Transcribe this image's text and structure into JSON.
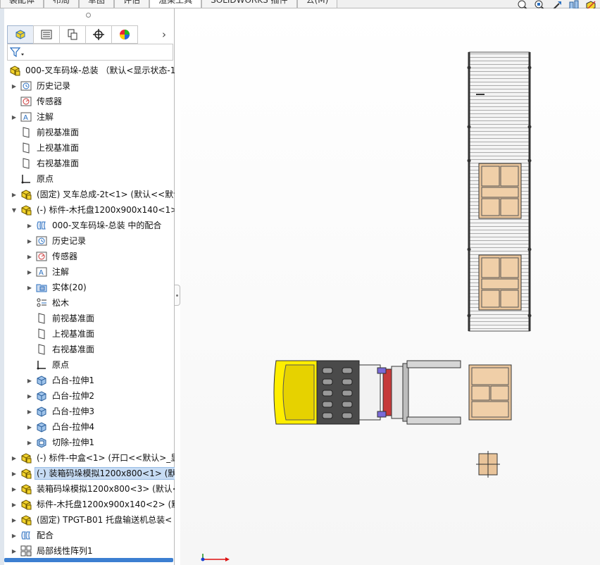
{
  "ribbon_tabs": [
    "装配体",
    "布局",
    "草图",
    "评估",
    "渲染工具",
    "SOLIDWORKS 插件",
    "公(M)"
  ],
  "active_ribbon_tab": 4,
  "view_tools": [
    "zoom-to-fit-icon",
    "zoom-to-area-icon",
    "previous-view-icon",
    "section-view-icon",
    "view-orientation-icon"
  ],
  "panel_tabs": [
    "feature-manager-icon",
    "property-manager-icon",
    "configuration-manager-icon",
    "dimxpert-icon",
    "display-manager-icon"
  ],
  "colors": {
    "selection": "#c7dcf4",
    "part_yellow": "#f2d22b",
    "pallet_wood": "#e9c49a",
    "forklift_yellow": "#ffee00",
    "scrollbar": "#3c7fd1"
  },
  "tree": [
    {
      "depth": 0,
      "expander": "none",
      "icon": "assembly-icon",
      "label": "000-叉车码垛-总装 （默认<显示状态-1>"
    },
    {
      "depth": 1,
      "expander": "closed",
      "icon": "history-icon",
      "label": "历史记录"
    },
    {
      "depth": 1,
      "expander": "none",
      "icon": "sensor-icon",
      "label": "传感器"
    },
    {
      "depth": 1,
      "expander": "closed",
      "icon": "annotation-icon",
      "label": "注解"
    },
    {
      "depth": 1,
      "expander": "none",
      "icon": "plane-icon",
      "label": "前视基准面"
    },
    {
      "depth": 1,
      "expander": "none",
      "icon": "plane-icon",
      "label": "上视基准面"
    },
    {
      "depth": 1,
      "expander": "none",
      "icon": "plane-icon",
      "label": "右视基准面"
    },
    {
      "depth": 1,
      "expander": "none",
      "icon": "origin-icon",
      "label": "原点"
    },
    {
      "depth": 1,
      "expander": "closed",
      "icon": "subassembly-icon",
      "label": "(固定) 叉车总成-2t<1> (默认<<默认"
    },
    {
      "depth": 1,
      "expander": "open",
      "icon": "subassembly-icon",
      "label": "(-) 标件-木托盘1200x900x140<1>"
    },
    {
      "depth": 2,
      "expander": "closed",
      "icon": "mates-folder-icon",
      "label": "000-叉车码垛-总装 中的配合"
    },
    {
      "depth": 2,
      "expander": "closed",
      "icon": "history-icon",
      "label": "历史记录"
    },
    {
      "depth": 2,
      "expander": "closed",
      "icon": "sensor-icon",
      "label": "传感器"
    },
    {
      "depth": 2,
      "expander": "closed",
      "icon": "annotation-icon",
      "label": "注解"
    },
    {
      "depth": 2,
      "expander": "closed",
      "icon": "solid-bodies-icon",
      "label": "实体(20)"
    },
    {
      "depth": 2,
      "expander": "none",
      "icon": "material-icon",
      "label": "松木"
    },
    {
      "depth": 2,
      "expander": "none",
      "icon": "plane-icon",
      "label": "前视基准面"
    },
    {
      "depth": 2,
      "expander": "none",
      "icon": "plane-icon",
      "label": "上视基准面"
    },
    {
      "depth": 2,
      "expander": "none",
      "icon": "plane-icon",
      "label": "右视基准面"
    },
    {
      "depth": 2,
      "expander": "none",
      "icon": "origin-icon",
      "label": "原点"
    },
    {
      "depth": 2,
      "expander": "closed",
      "icon": "extrude-icon",
      "label": "凸台-拉伸1"
    },
    {
      "depth": 2,
      "expander": "closed",
      "icon": "extrude-icon",
      "label": "凸台-拉伸2"
    },
    {
      "depth": 2,
      "expander": "closed",
      "icon": "extrude-icon",
      "label": "凸台-拉伸3"
    },
    {
      "depth": 2,
      "expander": "closed",
      "icon": "extrude-icon",
      "label": "凸台-拉伸4"
    },
    {
      "depth": 2,
      "expander": "closed",
      "icon": "cut-extrude-icon",
      "label": "切除-拉伸1"
    },
    {
      "depth": 1,
      "expander": "closed",
      "icon": "subassembly-icon",
      "label": "(-) 标件-中盒<1> (开口<<默认>_显"
    },
    {
      "depth": 1,
      "expander": "closed",
      "icon": "subassembly-icon",
      "label": "(-) 装箱码垛模拟1200x800<1> (默",
      "selected": true
    },
    {
      "depth": 1,
      "expander": "closed",
      "icon": "subassembly-icon",
      "label": "装箱码垛模拟1200x800<3> (默认<"
    },
    {
      "depth": 1,
      "expander": "closed",
      "icon": "subassembly-icon",
      "label": "标件-木托盘1200x900x140<2> (默"
    },
    {
      "depth": 1,
      "expander": "closed",
      "icon": "subassembly-icon",
      "label": "(固定) TPGT-B01 托盘输送机总装<"
    },
    {
      "depth": 1,
      "expander": "closed",
      "icon": "mates-folder-icon",
      "label": "配合"
    },
    {
      "depth": 1,
      "expander": "closed",
      "icon": "pattern-icon",
      "label": "局部线性阵列1"
    }
  ]
}
